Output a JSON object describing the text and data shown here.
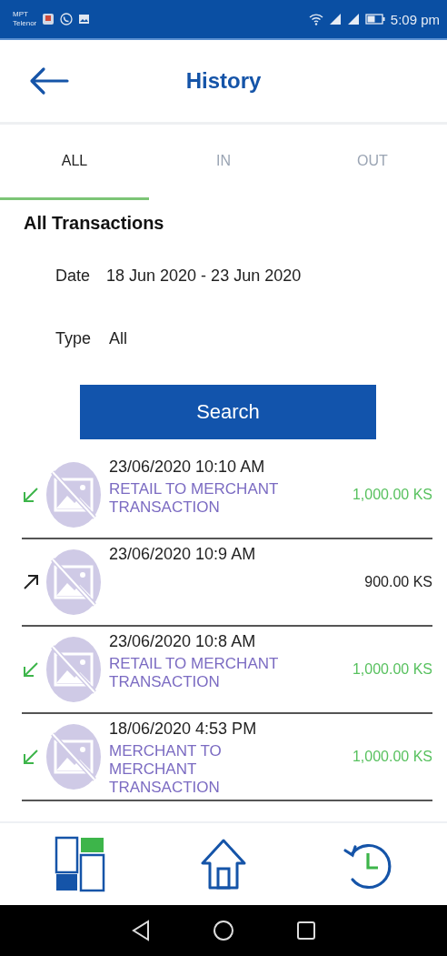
{
  "status_bar": {
    "carrier_top": "MPT",
    "carrier_bottom": "Telenor",
    "time": "5:09 pm"
  },
  "header": {
    "title": "History"
  },
  "tabs": [
    {
      "label": "ALL",
      "selected": true
    },
    {
      "label": "IN",
      "selected": false
    },
    {
      "label": "OUT",
      "selected": false
    }
  ],
  "filter": {
    "heading": "All Transactions",
    "date_label": "Date",
    "date_value": "18 Jun 2020 - 23 Jun 2020",
    "type_label": "Type",
    "type_value": "All",
    "button": "Search"
  },
  "transactions": [
    {
      "kind": "in",
      "datetime": "23/06/2020 10:10 AM",
      "description": "RETAIL TO MERCHANT TRANSACTION",
      "amount": "1,000.00 KS"
    },
    {
      "kind": "out",
      "datetime": "23/06/2020 10:9 AM",
      "amount": "900.00 KS"
    },
    {
      "kind": "in",
      "datetime": "23/06/2020 10:8 AM",
      "description": "RETAIL TO MERCHANT TRANSACTION",
      "amount": "1,000.00 KS"
    },
    {
      "kind": "in",
      "datetime": "18/06/2020 4:53 PM",
      "description": "MERCHANT TO MERCHANT TRANSACTION",
      "amount": "1,000.00 KS"
    }
  ]
}
